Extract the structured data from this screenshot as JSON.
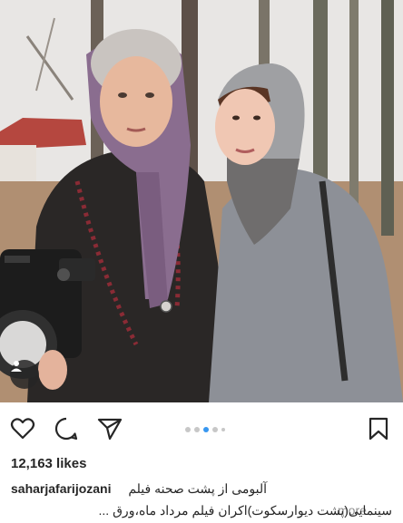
{
  "post": {
    "likes": "12,163 likes",
    "username": "saharjafarijozani",
    "caption_line1": "آلبومی از پشت صحنه فیلم",
    "caption_line2": "سینمایی(پشت دیوارسکوت)اکران فیلم مرداد ماه،ورق ...",
    "more_label": "more"
  },
  "carousel": {
    "total_dots": 5,
    "active_index": 2
  },
  "icons": {
    "like": "heart-outline-icon",
    "comment": "speech-bubble-icon",
    "share": "paper-plane-icon",
    "save": "bookmark-icon",
    "tag": "user-tag-icon"
  },
  "colors": {
    "text": "#262626",
    "muted": "#8e8e8e",
    "active_dot": "#3897f0",
    "inactive_dot": "#c7c7c7"
  }
}
